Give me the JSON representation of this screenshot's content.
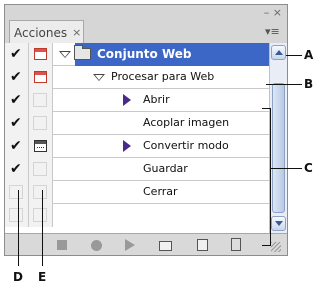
{
  "panel": {
    "tab_label": "Acciones",
    "tab_close": "×",
    "minimize_glyph": "–",
    "close_glyph": "×",
    "menu_glyph": "▾≡"
  },
  "rows": [
    {
      "kind": "set",
      "label": "Conjunto Web",
      "check": "✔",
      "dialog": "red"
    },
    {
      "kind": "action",
      "label": "Procesar para Web",
      "check": "✔",
      "dialog": "red"
    },
    {
      "kind": "command",
      "label": "Abrir",
      "check": "✔",
      "dialog": "none",
      "expand": true
    },
    {
      "kind": "command",
      "label": "Acoplar imagen",
      "check": "✔",
      "dialog": "none",
      "expand": false
    },
    {
      "kind": "command",
      "label": "Convertir modo",
      "check": "✔",
      "dialog": "dark",
      "expand": true
    },
    {
      "kind": "command",
      "label": "Guardar",
      "check": "✔",
      "dialog": "none",
      "expand": false
    },
    {
      "kind": "command",
      "label": "Cerrar",
      "check": "",
      "dialog": "none",
      "expand": false
    }
  ],
  "bottom_icons": [
    "stop-icon",
    "record-icon",
    "play-icon",
    "new-set-icon",
    "new-action-icon",
    "trash-icon"
  ],
  "callouts": {
    "a": "A",
    "b": "B",
    "c": "C",
    "d": "D",
    "e": "E"
  }
}
